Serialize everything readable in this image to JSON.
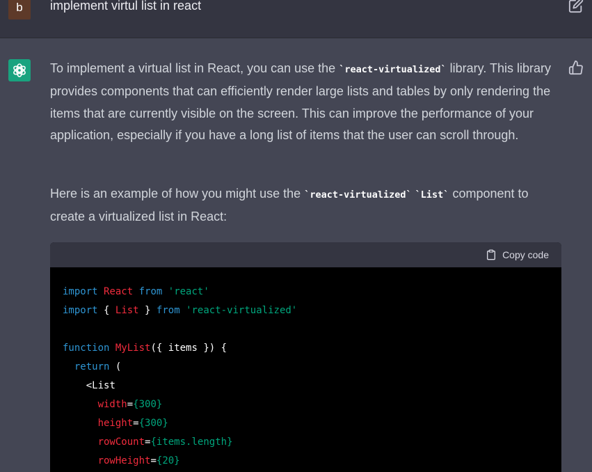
{
  "colors": {
    "page_bg": "#444654",
    "user_row_bg": "#343541",
    "user_avatar_bg": "#5e3a29",
    "assistant_avatar_bg": "#19a37f",
    "code_bg": "#000000",
    "keyword": "#2e95d3",
    "identifier": "#f22c3d",
    "string": "#00a67d"
  },
  "user": {
    "avatar_letter": "b",
    "prompt": "implement virtul list in react",
    "edit_icon": "pencil-square-icon"
  },
  "assistant": {
    "avatar_icon": "openai-logo-icon",
    "feedback_icon": "thumbs-up-icon",
    "para1": {
      "before": "To implement a virtual list in React, you can use the ",
      "code": "`react-virtualized`",
      "after": " library. This library provides components that can efficiently render large lists and tables by only rendering the items that are currently visible on the screen. This can improve the performance of your application, especially if you have a long list of items that the user can scroll through."
    },
    "para2": {
      "before": "Here is an example of how you might use the ",
      "code1": "`react-virtualized`",
      "gap": " ",
      "code2": "`List`",
      "after": " component to create a virtualized list in React:"
    },
    "code_block": {
      "copy_label": "Copy code",
      "copy_icon": "clipboard-icon",
      "lines": [
        "import React from 'react'",
        "import { List } from 'react-virtualized'",
        "",
        "function MyList({ items }) {",
        "  return (",
        "    <List",
        "      width={300}",
        "      height={300}",
        "      rowCount={items.length}",
        "      rowHeight={20}"
      ]
    }
  }
}
